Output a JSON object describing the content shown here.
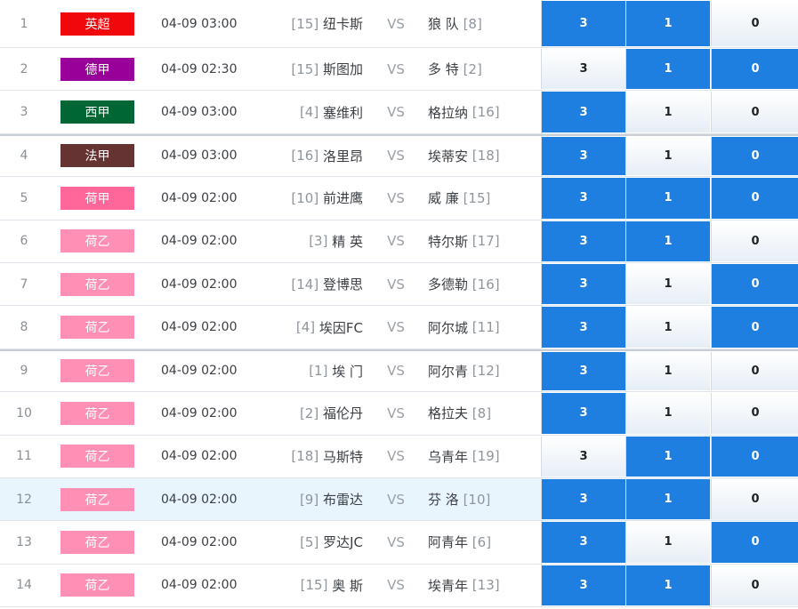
{
  "colors": {
    "selected_option": "#1f7fe0",
    "league": {
      "英超": "#f0080c",
      "德甲": "#990099",
      "西甲": "#006633",
      "法甲": "#663333",
      "荷甲": "#ff6699",
      "荷乙": "#ff8fb4"
    }
  },
  "matches": [
    {
      "num": "1",
      "league": "英超",
      "time": "04-09 03:00",
      "home_rank": "[15]",
      "home": "纽卡斯",
      "vs": "VS",
      "away": "狼 队",
      "away_rank": "[8]",
      "options": [
        "3",
        "1",
        "0"
      ],
      "selected": [
        true,
        true,
        false
      ]
    },
    {
      "num": "2",
      "league": "德甲",
      "time": "04-09 02:30",
      "home_rank": "[15]",
      "home": "斯图加",
      "vs": "VS",
      "away": "多 特",
      "away_rank": "[2]",
      "options": [
        "3",
        "1",
        "0"
      ],
      "selected": [
        false,
        true,
        true
      ]
    },
    {
      "num": "3",
      "league": "西甲",
      "time": "04-09 03:00",
      "home_rank": "[4]",
      "home": "塞维利",
      "vs": "VS",
      "away": "格拉纳",
      "away_rank": "[16]",
      "options": [
        "3",
        "1",
        "0"
      ],
      "selected": [
        true,
        false,
        false
      ]
    },
    {
      "num": "4",
      "league": "法甲",
      "time": "04-09 03:00",
      "home_rank": "[16]",
      "home": "洛里昂",
      "vs": "VS",
      "away": "埃蒂安",
      "away_rank": "[18]",
      "options": [
        "3",
        "1",
        "0"
      ],
      "selected": [
        true,
        false,
        true
      ]
    },
    {
      "num": "5",
      "league": "荷甲",
      "time": "04-09 02:00",
      "home_rank": "[10]",
      "home": "前进鹰",
      "vs": "VS",
      "away": "威 廉",
      "away_rank": "[15]",
      "options": [
        "3",
        "1",
        "0"
      ],
      "selected": [
        true,
        true,
        true
      ]
    },
    {
      "num": "6",
      "league": "荷乙",
      "time": "04-09 02:00",
      "home_rank": "[3]",
      "home": "精 英",
      "vs": "VS",
      "away": "特尔斯",
      "away_rank": "[17]",
      "options": [
        "3",
        "1",
        "0"
      ],
      "selected": [
        true,
        true,
        false
      ]
    },
    {
      "num": "7",
      "league": "荷乙",
      "time": "04-09 02:00",
      "home_rank": "[14]",
      "home": "登博思",
      "vs": "VS",
      "away": "多德勒",
      "away_rank": "[16]",
      "options": [
        "3",
        "1",
        "0"
      ],
      "selected": [
        true,
        false,
        true
      ]
    },
    {
      "num": "8",
      "league": "荷乙",
      "time": "04-09 02:00",
      "home_rank": "[4]",
      "home": "埃因FC",
      "vs": "VS",
      "away": "阿尔城",
      "away_rank": "[11]",
      "options": [
        "3",
        "1",
        "0"
      ],
      "selected": [
        true,
        false,
        true
      ]
    },
    {
      "num": "9",
      "league": "荷乙",
      "time": "04-09 02:00",
      "home_rank": "[1]",
      "home": "埃 门",
      "vs": "VS",
      "away": "阿尔青",
      "away_rank": "[12]",
      "options": [
        "3",
        "1",
        "0"
      ],
      "selected": [
        true,
        false,
        false
      ]
    },
    {
      "num": "10",
      "league": "荷乙",
      "time": "04-09 02:00",
      "home_rank": "[2]",
      "home": "福伦丹",
      "vs": "VS",
      "away": "格拉夫",
      "away_rank": "[8]",
      "options": [
        "3",
        "1",
        "0"
      ],
      "selected": [
        true,
        false,
        false
      ]
    },
    {
      "num": "11",
      "league": "荷乙",
      "time": "04-09 02:00",
      "home_rank": "[18]",
      "home": "马斯特",
      "vs": "VS",
      "away": "乌青年",
      "away_rank": "[19]",
      "options": [
        "3",
        "1",
        "0"
      ],
      "selected": [
        false,
        true,
        true
      ]
    },
    {
      "num": "12",
      "league": "荷乙",
      "time": "04-09 02:00",
      "home_rank": "[9]",
      "home": "布雷达",
      "vs": "VS",
      "away": "芬 洛",
      "away_rank": "[10]",
      "options": [
        "3",
        "1",
        "0"
      ],
      "selected": [
        true,
        true,
        false
      ]
    },
    {
      "num": "13",
      "league": "荷乙",
      "time": "04-09 02:00",
      "home_rank": "[5]",
      "home": "罗达JC",
      "vs": "VS",
      "away": "阿青年",
      "away_rank": "[6]",
      "options": [
        "3",
        "1",
        "0"
      ],
      "selected": [
        true,
        false,
        true
      ]
    },
    {
      "num": "14",
      "league": "荷乙",
      "time": "04-09 02:00",
      "home_rank": "[15]",
      "home": "奥 斯",
      "vs": "VS",
      "away": "埃青年",
      "away_rank": "[13]",
      "options": [
        "3",
        "1",
        "0"
      ],
      "selected": [
        true,
        true,
        false
      ]
    }
  ]
}
